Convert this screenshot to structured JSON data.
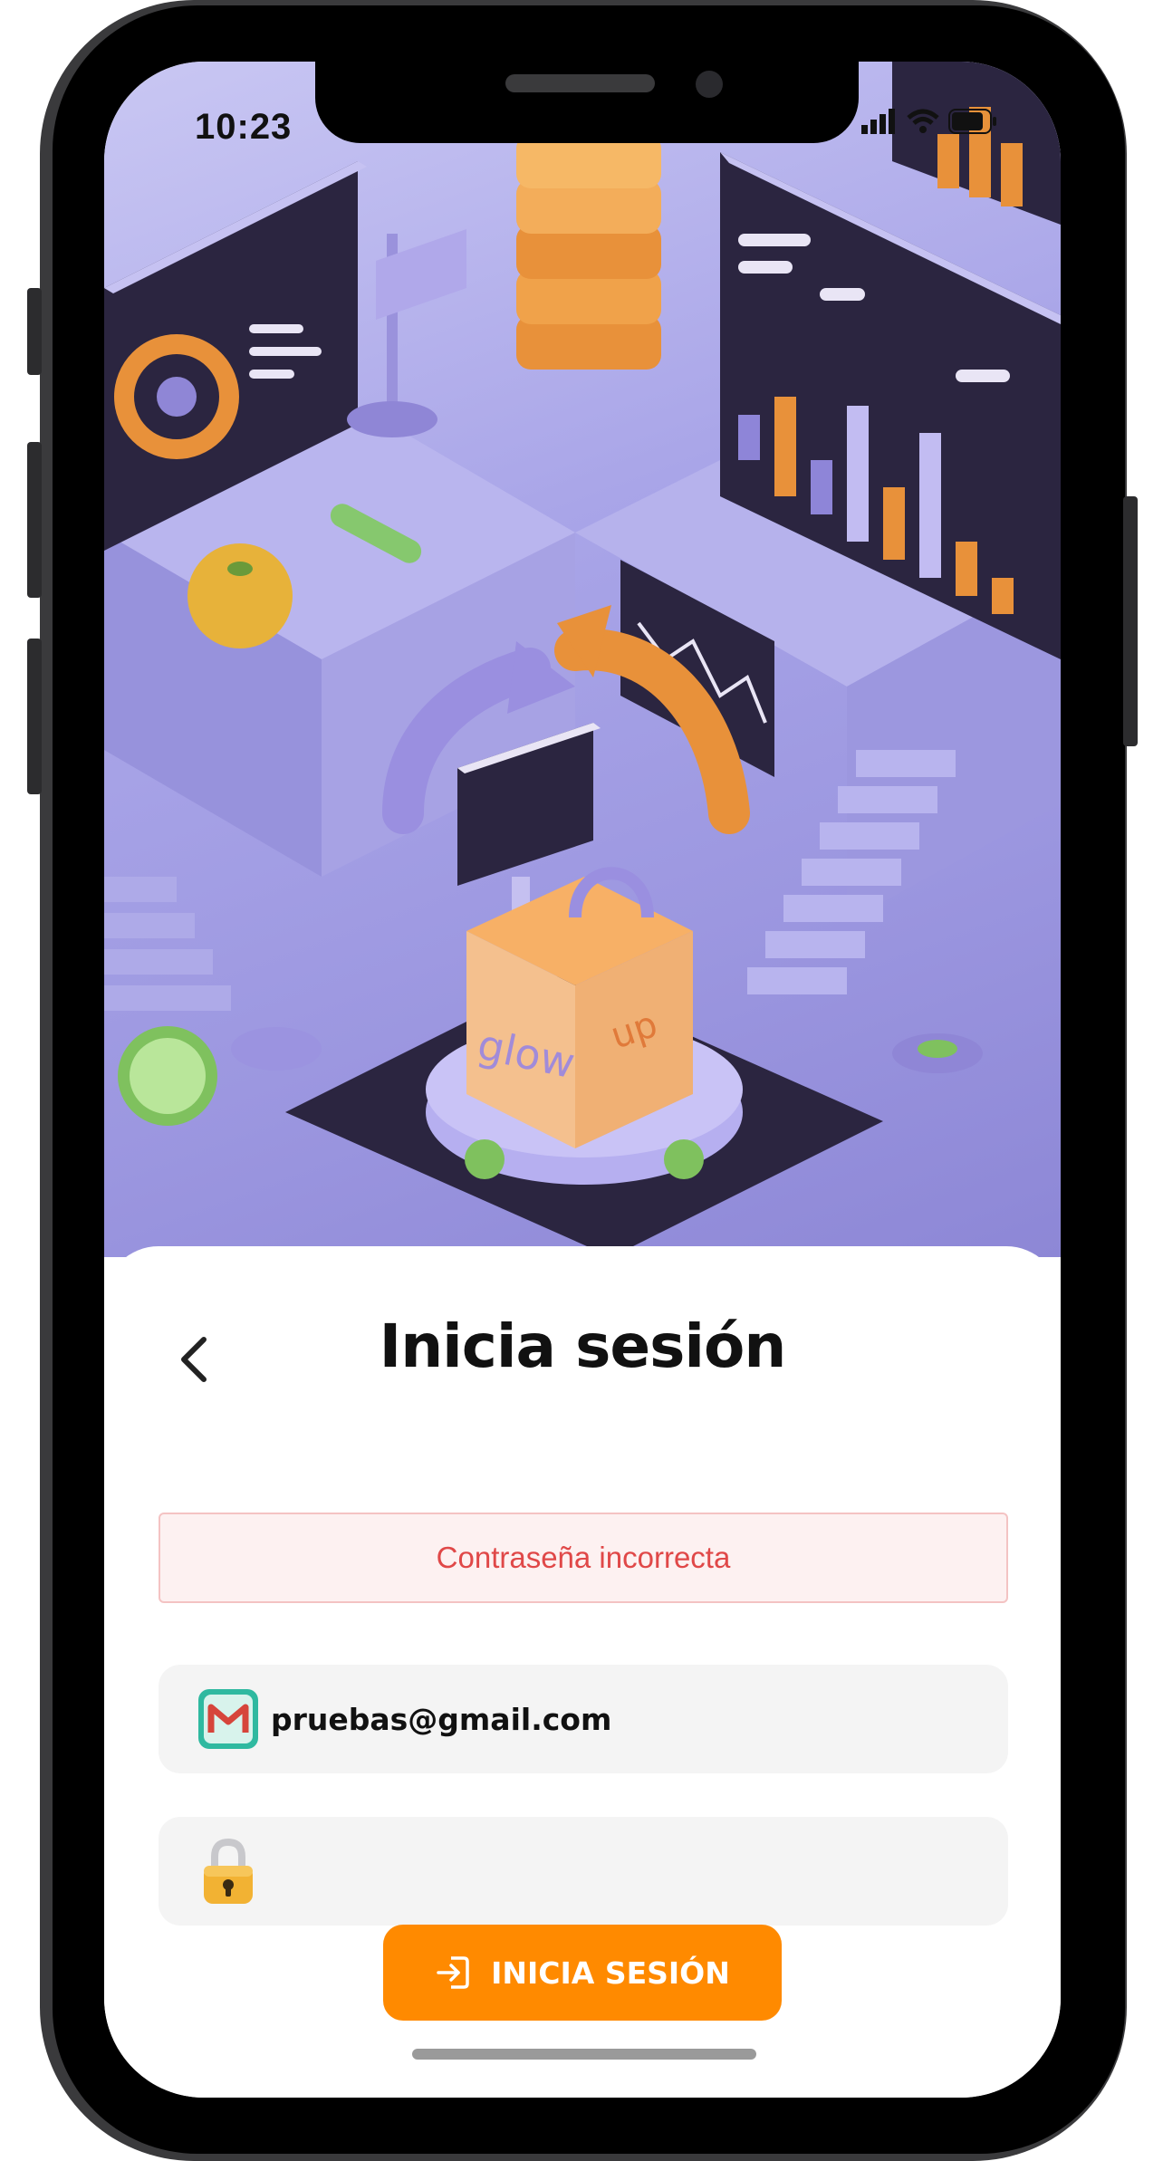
{
  "status_bar": {
    "time": "10:23"
  },
  "hero": {
    "sign_left": "glow",
    "sign_right": "up"
  },
  "login": {
    "title": "Inicia sesión",
    "error_message": "Contraseña incorrecta",
    "email_value": "pruebas@gmail.com",
    "password_value": "",
    "submit_label": "INICIA SESIÓN"
  },
  "colors": {
    "accent": "#ff8a00",
    "error_text": "#e04848",
    "error_background": "#fdf1f1",
    "field_background": "#f4f4f4",
    "hero_background": "#a9a5e8"
  },
  "icons": {
    "back": "chevron-left-icon",
    "email": "gmail-icon",
    "password": "padlock-icon",
    "submit": "login-icon"
  }
}
